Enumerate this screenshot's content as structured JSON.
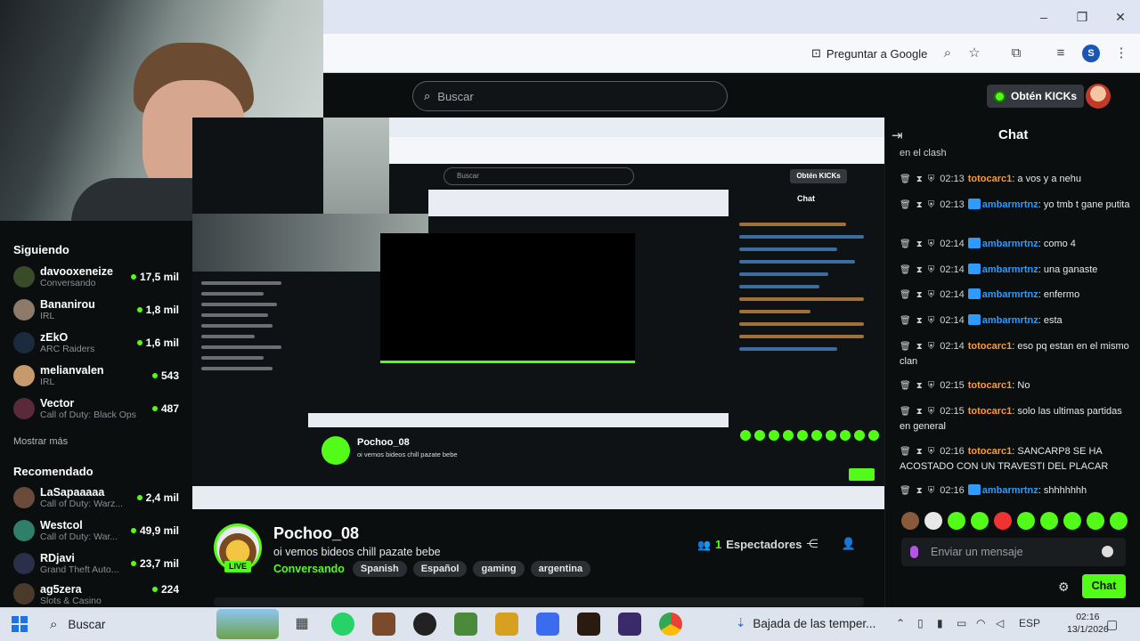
{
  "browser": {
    "ask_google": "Preguntar a Google",
    "profile_letter": "S"
  },
  "header": {
    "search_placeholder": "Buscar",
    "get_kicks": "Obtén KICKs"
  },
  "sidebar": {
    "following_heading": "Siguiendo",
    "following": [
      {
        "name": "davooxeneize",
        "category": "Conversando",
        "viewers": "17,5 mil"
      },
      {
        "name": "Bananirou",
        "category": "IRL",
        "viewers": "1,8 mil"
      },
      {
        "name": "zEkO",
        "category": "ARC Raiders",
        "viewers": "1,6 mil"
      },
      {
        "name": "melianvalen",
        "category": "IRL",
        "viewers": "543"
      },
      {
        "name": "Vector",
        "category": "Call of Duty: Black Ops",
        "viewers": "487"
      }
    ],
    "show_more": "Mostrar más",
    "recommended_heading": "Recomendado",
    "recommended": [
      {
        "name": "LaSapaaaaa",
        "category": "Call of Duty: Warz...",
        "viewers": "2,4 mil"
      },
      {
        "name": "Westcol",
        "category": "Call of Duty: War...",
        "viewers": "49,9 mil"
      },
      {
        "name": "RDjavi",
        "category": "Grand Theft Auto...",
        "viewers": "23,7 mil"
      },
      {
        "name": "ag5zera",
        "category": "Slots & Casino",
        "viewers": "224"
      }
    ]
  },
  "nested": {
    "search": "Buscar",
    "kicks": "Obtén KICKs",
    "chat": "Chat",
    "title": "Pochoo_08",
    "subtitle": "oi vemos bideos chill pazate bebe"
  },
  "channel": {
    "name": "Pochoo_08",
    "live": "LIVE",
    "title": "oi vemos bideos chill pazate bebe",
    "category": "Conversando",
    "tags": [
      "Spanish",
      "Español",
      "gaming",
      "argentina"
    ],
    "viewers_count": "1",
    "viewers_label": "Espectadores"
  },
  "chat": {
    "title": "Chat",
    "top_fragment": "en el clash",
    "messages": [
      {
        "time": "02:13",
        "user": "totocarc1",
        "color": "orange",
        "text": ": a vos y a nehu"
      },
      {
        "time": "02:13",
        "user": "ambarmrtnz",
        "color": "blue",
        "text": ": yo tmb t gane putita"
      },
      {
        "time": "02:14",
        "user": "ambarmrtnz",
        "color": "blue",
        "text": ": como 4"
      },
      {
        "time": "02:14",
        "user": "ambarmrtnz",
        "color": "blue",
        "text": ": una ganaste"
      },
      {
        "time": "02:14",
        "user": "ambarmrtnz",
        "color": "blue",
        "text": ": enfermo"
      },
      {
        "time": "02:14",
        "user": "ambarmrtnz",
        "color": "blue",
        "text": ": esta"
      },
      {
        "time": "02:14",
        "user": "totocarc1",
        "color": "orange",
        "text": ": eso pq estan en el mismo clan"
      },
      {
        "time": "02:15",
        "user": "totocarc1",
        "color": "orange",
        "text": ": No"
      },
      {
        "time": "02:15",
        "user": "totocarc1",
        "color": "orange",
        "text": ": solo las ultimas partidas en general"
      },
      {
        "time": "02:16",
        "user": "totocarc1",
        "color": "orange",
        "text": ": SANCARP8 SE HA ACOSTADO CON UN TRAVESTI DEL PLACAR"
      },
      {
        "time": "02:16",
        "user": "ambarmrtnz",
        "color": "blue",
        "text": ": shhhhhhh"
      }
    ],
    "input_placeholder": "Enviar un mensaje",
    "send": "Chat"
  },
  "taskbar": {
    "search": "Buscar",
    "weather": "Bajada de las temper...",
    "lang": "ESP",
    "time": "02:16",
    "date": "13/1/2026"
  },
  "colors": {
    "accent": "#53fc18",
    "user_orange": "#ff9a2e",
    "user_blue": "#2e9bff"
  }
}
